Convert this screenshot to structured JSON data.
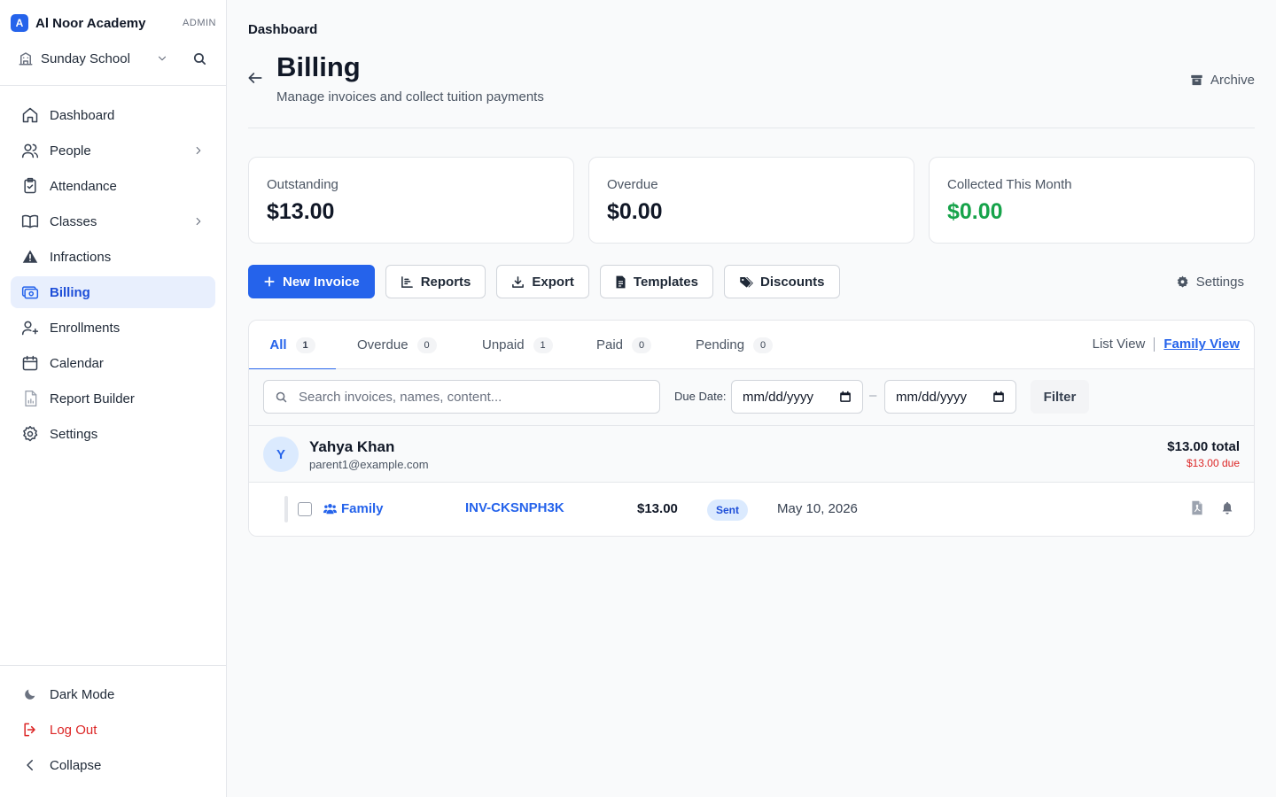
{
  "brand": {
    "logo_letter": "A",
    "name": "Al Noor Academy",
    "role": "ADMIN",
    "accent": "#2563eb"
  },
  "school": {
    "selected": "Sunday School",
    "icon": "building-icon"
  },
  "sidebar": {
    "items": [
      {
        "label": "Dashboard",
        "icon": "home-icon"
      },
      {
        "label": "People",
        "icon": "users-icon",
        "has_children": true
      },
      {
        "label": "Attendance",
        "icon": "clipboard-check-icon"
      },
      {
        "label": "Classes",
        "icon": "book-icon",
        "has_children": true
      },
      {
        "label": "Infractions",
        "icon": "warning-icon"
      },
      {
        "label": "Billing",
        "icon": "billing-icon",
        "active": true
      },
      {
        "label": "Enrollments",
        "icon": "user-plus-icon"
      },
      {
        "label": "Calendar",
        "icon": "calendar-icon"
      },
      {
        "label": "Report Builder",
        "icon": "report-icon"
      },
      {
        "label": "Settings",
        "icon": "gear-icon"
      }
    ],
    "bottom": [
      {
        "label": "Dark Mode",
        "icon": "moon-icon"
      },
      {
        "label": "Log Out",
        "icon": "logout-icon"
      },
      {
        "label": "Collapse",
        "icon": "chevron-left-icon"
      }
    ]
  },
  "header": {
    "breadcrumb": "Dashboard",
    "title": "Billing",
    "subtitle": "Manage invoices and collect tuition payments",
    "archive_label": "Archive"
  },
  "stats": [
    {
      "label": "Outstanding",
      "value": "$13.00"
    },
    {
      "label": "Overdue",
      "value": "$0.00"
    },
    {
      "label": "Collected This Month",
      "value": "$0.00",
      "color": "#16a34a"
    }
  ],
  "toolbar": {
    "new_invoice": "New Invoice",
    "reports": "Reports",
    "export": "Export",
    "templates": "Templates",
    "discounts": "Discounts",
    "settings": "Settings"
  },
  "tabs": [
    {
      "label": "All",
      "count": "1",
      "active": true
    },
    {
      "label": "Overdue",
      "count": "0"
    },
    {
      "label": "Unpaid",
      "count": "1"
    },
    {
      "label": "Paid",
      "count": "0"
    },
    {
      "label": "Pending",
      "count": "0"
    }
  ],
  "views": {
    "list": "List View",
    "family": "Family View",
    "active": "family"
  },
  "filters": {
    "search_placeholder": "Search invoices, names, content...",
    "due_date_label": "Due Date:",
    "date_from": "mm/dd/yyyy",
    "date_separator": "–",
    "date_to": "mm/dd/yyyy",
    "filter_label": "Filter"
  },
  "group": {
    "avatar_letter": "Y",
    "name": "Yahya Khan",
    "email": "parent1@example.com",
    "total": "$13.00 total",
    "due": "$13.00 due"
  },
  "invoices": [
    {
      "type": "Family",
      "number": "INV-CKSNPH3K",
      "amount": "$13.00",
      "status": "Sent",
      "date": "May 10, 2026"
    }
  ]
}
